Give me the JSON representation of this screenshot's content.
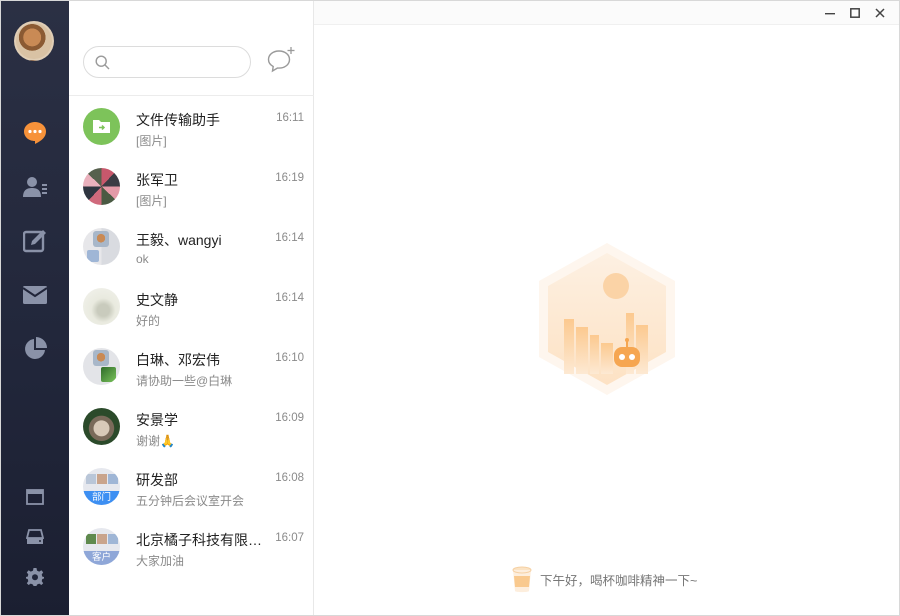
{
  "window": {
    "buttons": {
      "minimize": "—",
      "maximize": "□",
      "close": "✕"
    }
  },
  "sidebar": {
    "items": [
      {
        "id": "messages",
        "icon": "chat-bubble-icon",
        "active": true
      },
      {
        "id": "contacts",
        "icon": "contacts-icon",
        "active": false
      },
      {
        "id": "notes",
        "icon": "edit-note-icon",
        "active": false
      },
      {
        "id": "mail",
        "icon": "mail-icon",
        "active": false
      },
      {
        "id": "stats",
        "icon": "pie-chart-icon",
        "active": false
      }
    ],
    "bottom_items": [
      {
        "id": "window",
        "icon": "window-icon"
      },
      {
        "id": "drive",
        "icon": "drive-icon"
      },
      {
        "id": "settings",
        "icon": "gear-icon"
      }
    ],
    "accent": "#f7923a"
  },
  "search": {
    "placeholder": "",
    "value": ""
  },
  "conversations": [
    {
      "name": "文件传输助手",
      "time": "16:11",
      "preview": "[图片]",
      "avatar": "file-transfer"
    },
    {
      "name": "张军卫",
      "time": "16:19",
      "preview": "[图片]",
      "avatar": "photo"
    },
    {
      "name": "王毅、wangyi",
      "time": "16:14",
      "preview": "ok",
      "avatar": "group"
    },
    {
      "name": "史文静",
      "time": "16:14",
      "preview": "好的",
      "avatar": "photo"
    },
    {
      "name": "白琳、邓宏伟",
      "time": "16:10",
      "preview": "请协助一些@白琳",
      "avatar": "group"
    },
    {
      "name": "安景学",
      "time": "16:09",
      "preview": "谢谢🙏",
      "avatar": "photo"
    },
    {
      "name": "研发部",
      "time": "16:08",
      "preview": "五分钟后会议室开会",
      "avatar": "group",
      "tag": "部门",
      "tag_color": "#3d8ff2"
    },
    {
      "name": "北京橘子科技有限公司",
      "time": "16:07",
      "preview": "大家加油",
      "avatar": "group",
      "tag": "客户",
      "tag_color": "#8fa7d8"
    }
  ],
  "main": {
    "greeting": "下午好，喝杯咖啡精神一下~"
  }
}
